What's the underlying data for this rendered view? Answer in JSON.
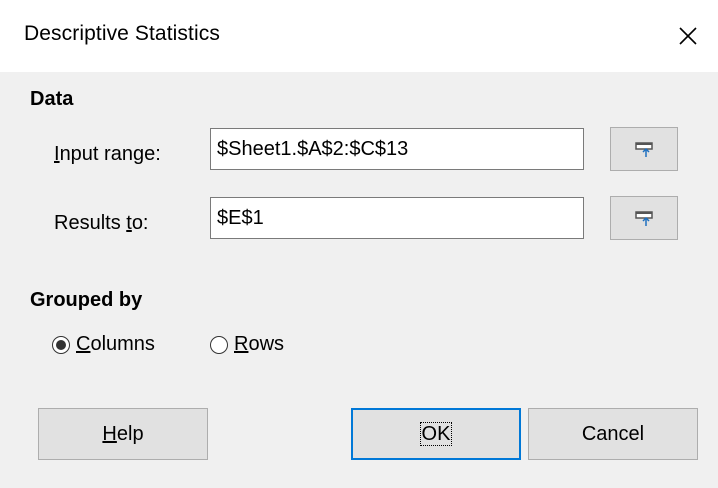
{
  "window": {
    "title": "Descriptive Statistics",
    "close_icon": "close-icon"
  },
  "data_section": {
    "heading": "Data",
    "input_range": {
      "label_underlined": "I",
      "label_rest": "nput range:",
      "value": "$Sheet1.$A$2:$C$13",
      "shrink_icon": "shrink-icon"
    },
    "results_to": {
      "label_prefix": "Results ",
      "label_underlined": "t",
      "label_suffix": "o:",
      "value": "$E$1",
      "shrink_icon": "shrink-icon"
    }
  },
  "grouped_section": {
    "heading": "Grouped by",
    "options": [
      {
        "label_underlined": "C",
        "label_rest": "olumns",
        "selected": true
      },
      {
        "label_underlined": "R",
        "label_rest": "ows",
        "selected": false
      }
    ]
  },
  "buttons": {
    "help": {
      "underlined": "H",
      "rest": "elp"
    },
    "ok": "OK",
    "cancel": "Cancel"
  },
  "colors": {
    "accent": "#0078d7",
    "panel_bg": "#f0f0f0",
    "button_bg": "#e1e1e1"
  }
}
